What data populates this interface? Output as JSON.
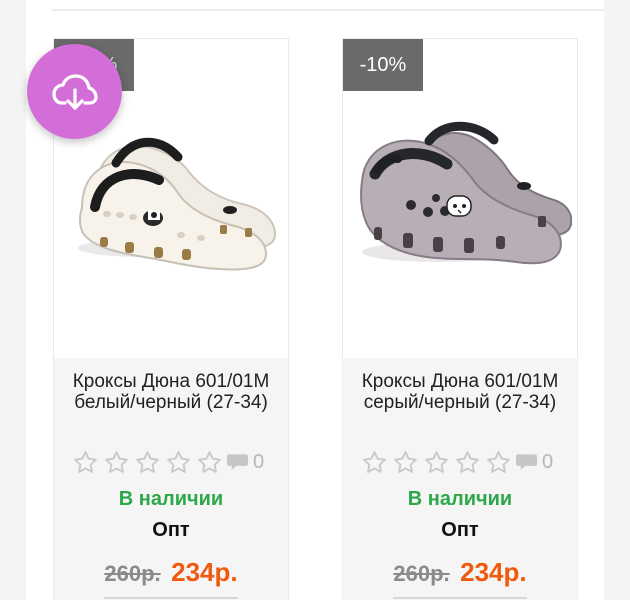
{
  "products": [
    {
      "discount_badge": "-10%",
      "name": "Кроксы Дюна 601/01М белый/черный (27-34)",
      "rating_count": "0",
      "stock_status": "В наличии",
      "wholesale_label": "Опт",
      "old_price": "260р.",
      "new_price": "234р.",
      "shoe_color": "#eeeae1",
      "image_icon": "white-black-clog-image"
    },
    {
      "discount_badge": "-10%",
      "name": "Кроксы Дюна 601/01М серый/черный (27-34)",
      "rating_count": "0",
      "stock_status": "В наличии",
      "wholesale_label": "Опт",
      "old_price": "260р.",
      "new_price": "234р.",
      "shoe_color": "#b5aab3",
      "image_icon": "gray-black-clog-image"
    }
  ],
  "fab": {
    "icon": "cloud-download-icon",
    "color": "#d36ed8"
  },
  "colors": {
    "stock_green": "#2ca84a",
    "price_orange": "#ef5a0e",
    "badge_gray": "#6a6a6a"
  }
}
